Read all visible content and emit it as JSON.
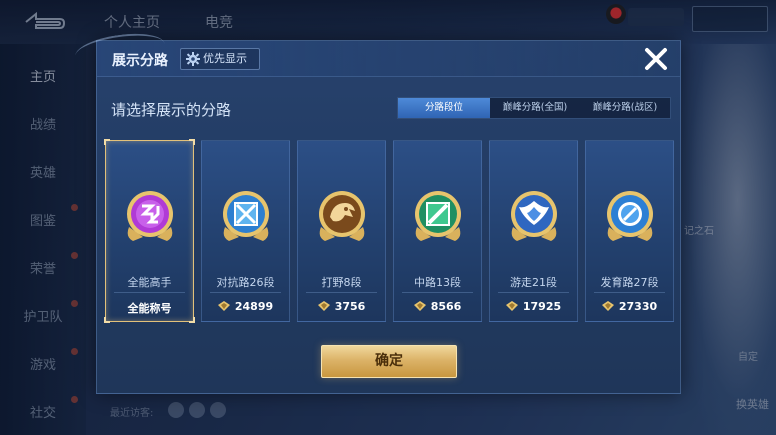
{
  "background": {
    "tabs": [
      "个人主页",
      "电竞"
    ],
    "sidebar": [
      "主页",
      "战绩",
      "英雄",
      "图鉴",
      "荣誉",
      "护卫队",
      "游戏",
      "社交"
    ],
    "right_labels": [
      "记之石",
      "换英雄",
      "自定"
    ],
    "bottom_text": "最近访客:"
  },
  "modal": {
    "title": "展示分路",
    "priority_label": "优先显示",
    "subtitle": "请选择展示的分路",
    "segments": [
      "分路段位",
      "巅峰分路(全国)",
      "巅峰分路(战区)"
    ],
    "active_segment": "分路段位",
    "cards": [
      {
        "name": "全能高手",
        "value": "全能称号",
        "icon": "all-round-badge-icon",
        "selected": true,
        "show_coin": false
      },
      {
        "name": "对抗路26段",
        "value": "24899",
        "icon": "clash-lane-badge-icon",
        "selected": false,
        "show_coin": true
      },
      {
        "name": "打野8段",
        "value": "3756",
        "icon": "jungle-badge-icon",
        "selected": false,
        "show_coin": true
      },
      {
        "name": "中路13段",
        "value": "8566",
        "icon": "mid-lane-badge-icon",
        "selected": false,
        "show_coin": true
      },
      {
        "name": "游走21段",
        "value": "17925",
        "icon": "roam-badge-icon",
        "selected": false,
        "show_coin": true
      },
      {
        "name": "发育路27段",
        "value": "27330",
        "icon": "farm-lane-badge-icon",
        "selected": false,
        "show_coin": true
      }
    ],
    "confirm_label": "确定"
  },
  "colors": {
    "accent_blue": "#3f78c8",
    "gold": "#dcb368",
    "selected_border": "#e2c17a",
    "badge_colors": [
      "#b03ad6",
      "#3a9be0",
      "#b07a30",
      "#2fb37a",
      "#3a7fd9",
      "#3a8ee0"
    ]
  }
}
